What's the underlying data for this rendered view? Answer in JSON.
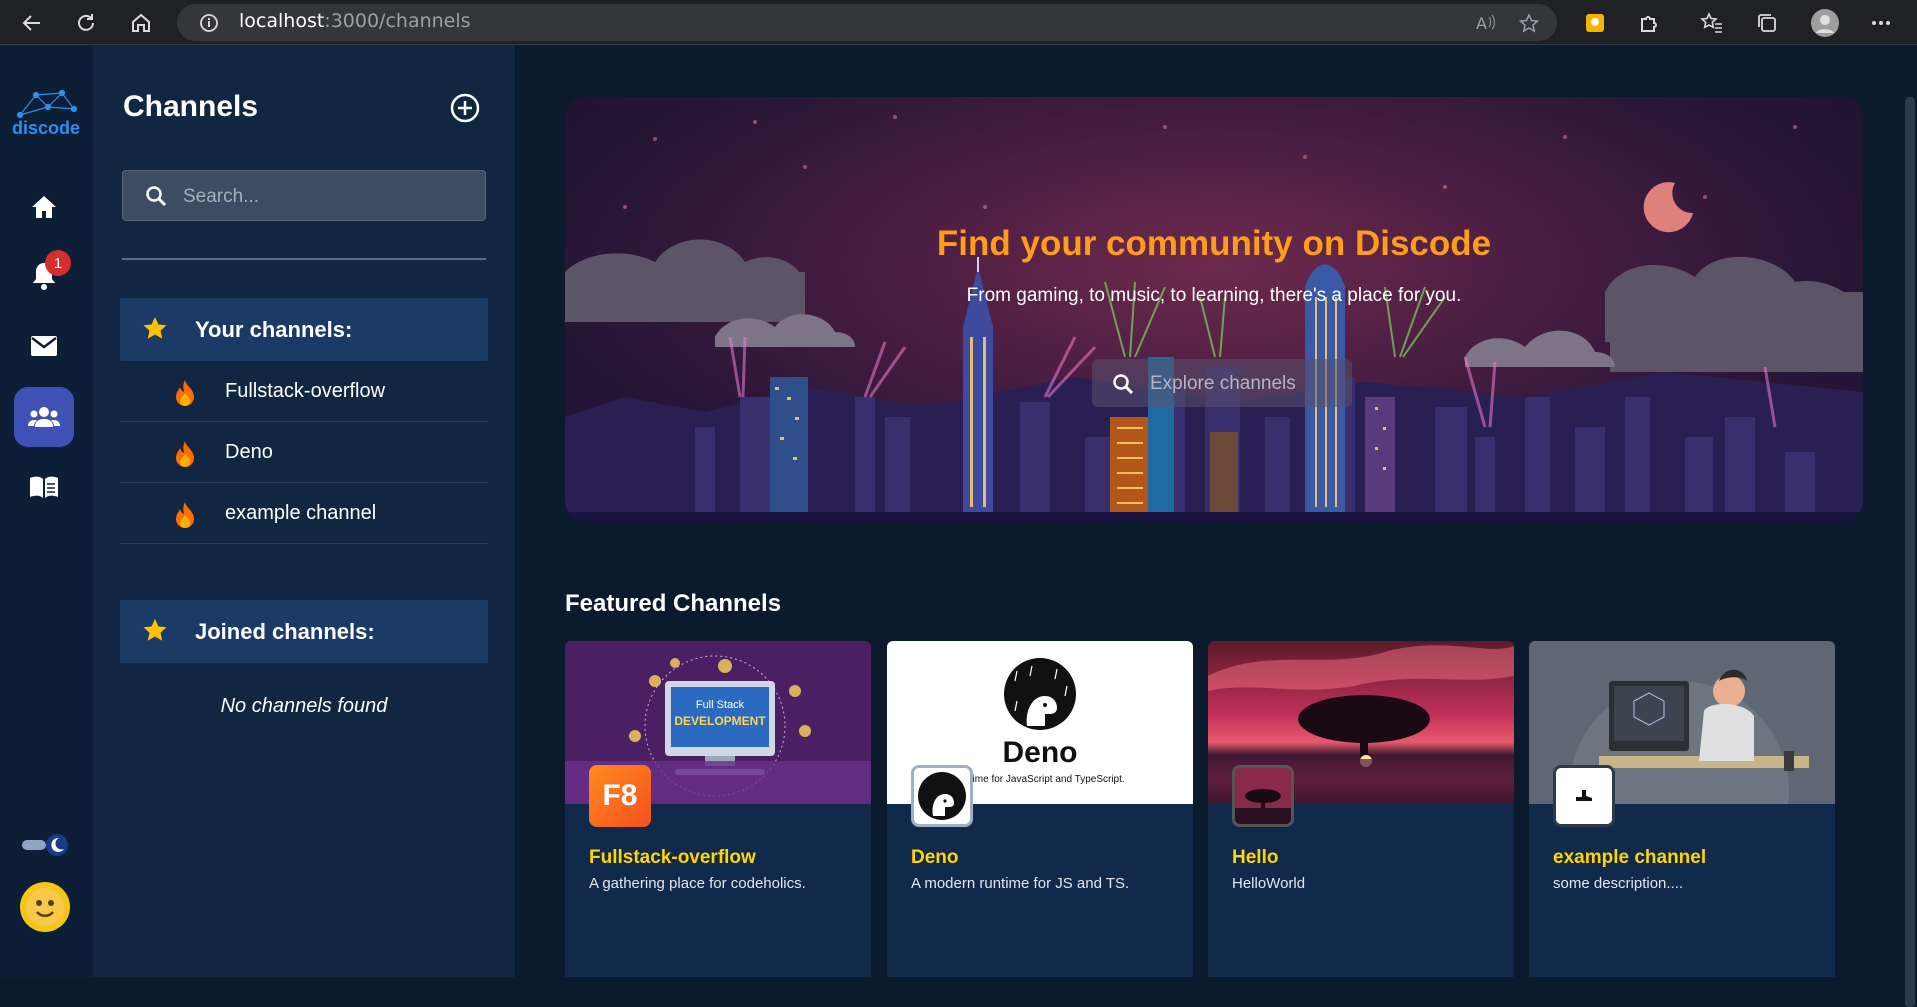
{
  "browser": {
    "url_host": "localhost",
    "url_path": ":3000/channels"
  },
  "rail": {
    "logo_text": "discode",
    "notification_count": "1"
  },
  "panel": {
    "title": "Channels",
    "search_placeholder": "Search...",
    "your_channels_label": "Your channels:",
    "your_channels": [
      {
        "label": "Fullstack-overflow"
      },
      {
        "label": "Deno"
      },
      {
        "label": "example channel"
      }
    ],
    "joined_channels_label": "Joined channels:",
    "joined_empty": "No channels found"
  },
  "hero": {
    "title": "Find your community on Discode",
    "subtitle": "From gaming, to music, to learning, there's a place for you.",
    "search_placeholder": "Explore channels"
  },
  "featured": {
    "title": "Featured Channels",
    "cards": [
      {
        "name": "Fullstack-overflow",
        "description": "A gathering place for codeholics.",
        "banner_text_1": "Full Stack",
        "banner_text_2": "DEVELOPMENT",
        "icon_text": "F8"
      },
      {
        "name": "Deno",
        "description": "A modern runtime for JS and TS.",
        "banner_text_1": "Deno",
        "banner_text_2": "runtime for JavaScript and TypeScript."
      },
      {
        "name": "Hello",
        "description": "HelloWorld"
      },
      {
        "name": "example channel",
        "description": "some description...."
      }
    ]
  },
  "colors": {
    "accent": "#3f51b5",
    "hero_title": "#ff9d1b",
    "card_name": "#ffd600",
    "badge": "#d32f2f"
  }
}
